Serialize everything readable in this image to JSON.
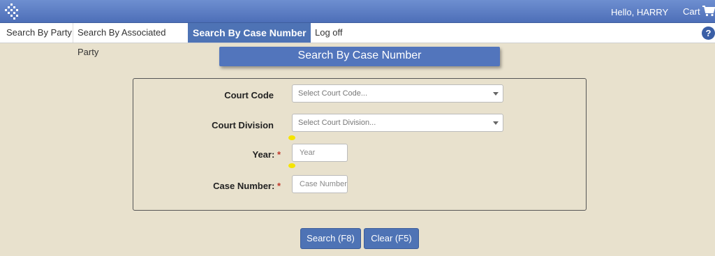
{
  "header": {
    "greeting": "Hello, HARRY",
    "cart_label": "Cart"
  },
  "nav": {
    "tabs": [
      {
        "label": "Search By Party"
      },
      {
        "label": "Search By Associated Party"
      },
      {
        "label": "Search By Case Number"
      },
      {
        "label": "Log off"
      }
    ],
    "help_label": "?"
  },
  "page": {
    "title": "Search By Case Number"
  },
  "form": {
    "court_code": {
      "label": "Court Code",
      "placeholder": "Select Court Code..."
    },
    "court_division": {
      "label": "Court Division",
      "placeholder": "Select Court Division..."
    },
    "year": {
      "label": "Year:",
      "required_mark": "*",
      "placeholder": "Year"
    },
    "case_number": {
      "label": "Case Number:",
      "required_mark": "*",
      "placeholder": "Case Number"
    }
  },
  "buttons": {
    "search": "Search (F8)",
    "clear": "Clear (F5)"
  },
  "colors": {
    "accent": "#4e73b5",
    "background": "#e8e1cd",
    "required": "#c0392b"
  }
}
